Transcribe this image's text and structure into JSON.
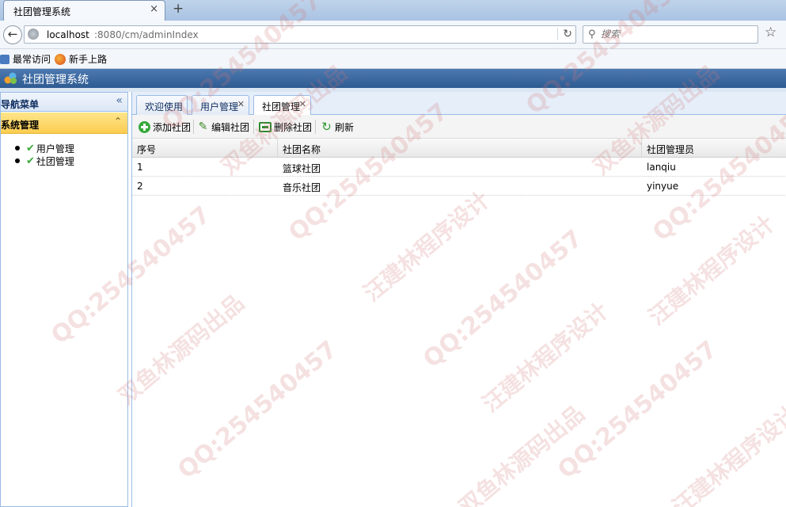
{
  "browser": {
    "tab_title": "社团管理系统",
    "tab_close": "×",
    "new_tab": "+",
    "url_host": "localhost",
    "url_path": ":8080/cm/adminIndex",
    "search_placeholder": "搜索",
    "bookmarks": [
      "最常访问",
      "新手上路"
    ]
  },
  "app": {
    "title": "社团管理系统"
  },
  "sidebar": {
    "title": "导航菜单",
    "section_title": "系统管理",
    "items": [
      {
        "label": "用户管理"
      },
      {
        "label": "社团管理"
      }
    ]
  },
  "tabs": [
    {
      "label": "欢迎使用",
      "closable": false
    },
    {
      "label": "用户管理",
      "closable": true
    },
    {
      "label": "社团管理",
      "closable": true,
      "active": true
    }
  ],
  "toolbar": {
    "add_label": "添加社团",
    "edit_label": "编辑社团",
    "delete_label": "删除社团",
    "refresh_label": "刷新"
  },
  "grid": {
    "columns": [
      "序号",
      "社团名称",
      "社团管理员"
    ],
    "rows": [
      [
        "1",
        "篮球社团",
        "lanqiu"
      ],
      [
        "2",
        "音乐社团",
        "yinyue"
      ]
    ]
  },
  "watermark": {
    "qq": "QQ:254540457",
    "text_a": "双鱼林源码出品",
    "text_b": "汪建林程序设计"
  },
  "colors": {
    "header_blue": "#2d5b92",
    "accordion_yellow": "#fbcc4f",
    "panel_border": "#99bbe8"
  }
}
